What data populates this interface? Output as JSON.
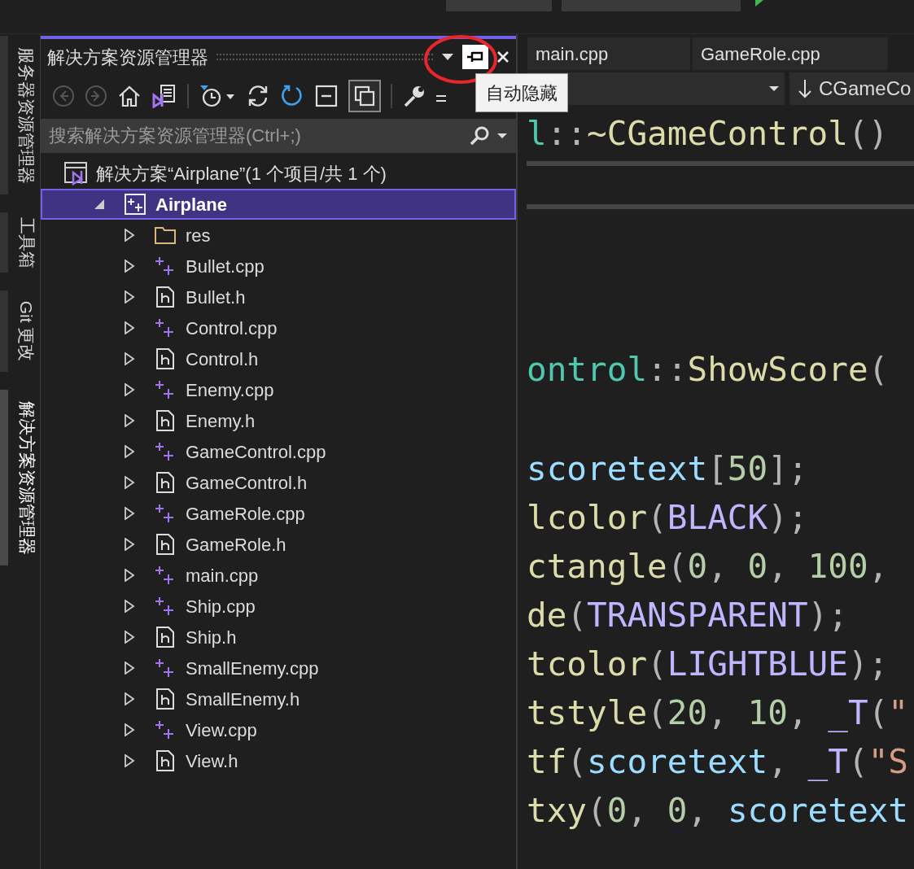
{
  "side_tabs": [
    {
      "label": "服务器资源管理器",
      "selected": false
    },
    {
      "label": "工具箱",
      "selected": false
    },
    {
      "label": "Git 更改",
      "selected": false
    },
    {
      "label": "解决方案资源管理器",
      "selected": true
    }
  ],
  "explorer": {
    "title": "解决方案资源管理器",
    "tooltip": "自动隐藏",
    "search": {
      "placeholder": "搜索解决方案资源管理器(Ctrl+;)"
    },
    "tree": [
      {
        "name": "解决方案“Airplane”(1 个项目/共 1 个)",
        "kind": "solution",
        "selected": false,
        "children": [
          {
            "name": "Airplane",
            "kind": "project",
            "selected": true,
            "expanded": true,
            "children": [
              {
                "name": "res",
                "kind": "folder",
                "selected": false,
                "expanded": false
              },
              {
                "name": "Bullet.cpp",
                "kind": "cpp",
                "selected": false,
                "expanded": false
              },
              {
                "name": "Bullet.h",
                "kind": "h",
                "selected": false,
                "expanded": false
              },
              {
                "name": "Control.cpp",
                "kind": "cpp",
                "selected": false,
                "expanded": false
              },
              {
                "name": "Control.h",
                "kind": "h",
                "selected": false,
                "expanded": false
              },
              {
                "name": "Enemy.cpp",
                "kind": "cpp",
                "selected": false,
                "expanded": false
              },
              {
                "name": "Enemy.h",
                "kind": "h",
                "selected": false,
                "expanded": false
              },
              {
                "name": "GameControl.cpp",
                "kind": "cpp",
                "selected": false,
                "expanded": false
              },
              {
                "name": "GameControl.h",
                "kind": "h",
                "selected": false,
                "expanded": false
              },
              {
                "name": "GameRole.cpp",
                "kind": "cpp",
                "selected": false,
                "expanded": false
              },
              {
                "name": "GameRole.h",
                "kind": "h",
                "selected": false,
                "expanded": false
              },
              {
                "name": "main.cpp",
                "kind": "cpp",
                "selected": false,
                "expanded": false
              },
              {
                "name": "Ship.cpp",
                "kind": "cpp",
                "selected": false,
                "expanded": false
              },
              {
                "name": "Ship.h",
                "kind": "h",
                "selected": false,
                "expanded": false
              },
              {
                "name": "SmallEnemy.cpp",
                "kind": "cpp",
                "selected": false,
                "expanded": false
              },
              {
                "name": "SmallEnemy.h",
                "kind": "h",
                "selected": false,
                "expanded": false
              },
              {
                "name": "View.cpp",
                "kind": "cpp",
                "selected": false,
                "expanded": false
              },
              {
                "name": "View.h",
                "kind": "h",
                "selected": false,
                "expanded": false
              }
            ]
          }
        ]
      }
    ]
  },
  "editor": {
    "tabs": [
      {
        "label": "main.cpp",
        "selected": false
      },
      {
        "label": "GameRole.cpp",
        "selected": false
      }
    ],
    "member_dropdown": "CGameCo",
    "lines": [
      {
        "kind": "code",
        "tokens": [
          {
            "t": "l",
            "kind": "type"
          },
          {
            "t": "::",
            "kind": "punc"
          },
          {
            "t": "~CGameControl",
            "kind": "fn"
          },
          {
            "t": "()",
            "kind": "punc"
          }
        ]
      },
      {
        "kind": "separator"
      },
      {
        "kind": "separator"
      },
      {
        "kind": "blank"
      },
      {
        "kind": "blank"
      },
      {
        "kind": "code",
        "tokens": [
          {
            "t": "ontrol",
            "kind": "type"
          },
          {
            "t": "::",
            "kind": "punc"
          },
          {
            "t": "ShowScore",
            "kind": "fn"
          },
          {
            "t": "(",
            "kind": "punc"
          }
        ]
      },
      {
        "kind": "blank"
      },
      {
        "kind": "code",
        "tokens": [
          {
            "t": "scoretext",
            "kind": "var"
          },
          {
            "t": "[",
            "kind": "punc"
          },
          {
            "t": "50",
            "kind": "num"
          },
          {
            "t": "];",
            "kind": "punc"
          }
        ]
      },
      {
        "kind": "code",
        "tokens": [
          {
            "t": "lcolor",
            "kind": "fn"
          },
          {
            "t": "(",
            "kind": "punc"
          },
          {
            "t": "BLACK",
            "kind": "macro"
          },
          {
            "t": ");",
            "kind": "punc"
          }
        ]
      },
      {
        "kind": "code",
        "tokens": [
          {
            "t": "ctangle",
            "kind": "fn"
          },
          {
            "t": "(",
            "kind": "punc"
          },
          {
            "t": "0",
            "kind": "num"
          },
          {
            "t": ", ",
            "kind": "punc"
          },
          {
            "t": "0",
            "kind": "num"
          },
          {
            "t": ", ",
            "kind": "punc"
          },
          {
            "t": "100",
            "kind": "num"
          },
          {
            "t": ",",
            "kind": "punc"
          }
        ]
      },
      {
        "kind": "code",
        "tokens": [
          {
            "t": "de",
            "kind": "fn"
          },
          {
            "t": "(",
            "kind": "punc"
          },
          {
            "t": "TRANSPARENT",
            "kind": "macro"
          },
          {
            "t": ");",
            "kind": "punc"
          }
        ]
      },
      {
        "kind": "code",
        "tokens": [
          {
            "t": "tcolor",
            "kind": "fn"
          },
          {
            "t": "(",
            "kind": "punc"
          },
          {
            "t": "LIGHTBLUE",
            "kind": "macro"
          },
          {
            "t": ");",
            "kind": "punc"
          }
        ]
      },
      {
        "kind": "code",
        "tokens": [
          {
            "t": "tstyle",
            "kind": "fn"
          },
          {
            "t": "(",
            "kind": "punc"
          },
          {
            "t": "20",
            "kind": "num"
          },
          {
            "t": ", ",
            "kind": "punc"
          },
          {
            "t": "10",
            "kind": "num"
          },
          {
            "t": ", ",
            "kind": "punc"
          },
          {
            "t": "_T",
            "kind": "macro"
          },
          {
            "t": "(",
            "kind": "punc"
          },
          {
            "t": "\"",
            "kind": "str"
          }
        ]
      },
      {
        "kind": "code",
        "tokens": [
          {
            "t": "tf",
            "kind": "fn"
          },
          {
            "t": "(",
            "kind": "punc"
          },
          {
            "t": "scoretext",
            "kind": "var"
          },
          {
            "t": ", ",
            "kind": "punc"
          },
          {
            "t": "_T",
            "kind": "macro"
          },
          {
            "t": "(",
            "kind": "punc"
          },
          {
            "t": "\"S",
            "kind": "str"
          }
        ]
      },
      {
        "kind": "code",
        "tokens": [
          {
            "t": "txy",
            "kind": "fn"
          },
          {
            "t": "(",
            "kind": "punc"
          },
          {
            "t": "0",
            "kind": "num"
          },
          {
            "t": ", ",
            "kind": "punc"
          },
          {
            "t": "0",
            "kind": "num"
          },
          {
            "t": ", ",
            "kind": "punc"
          },
          {
            "t": "scoretext",
            "kind": "var"
          }
        ]
      }
    ]
  }
}
